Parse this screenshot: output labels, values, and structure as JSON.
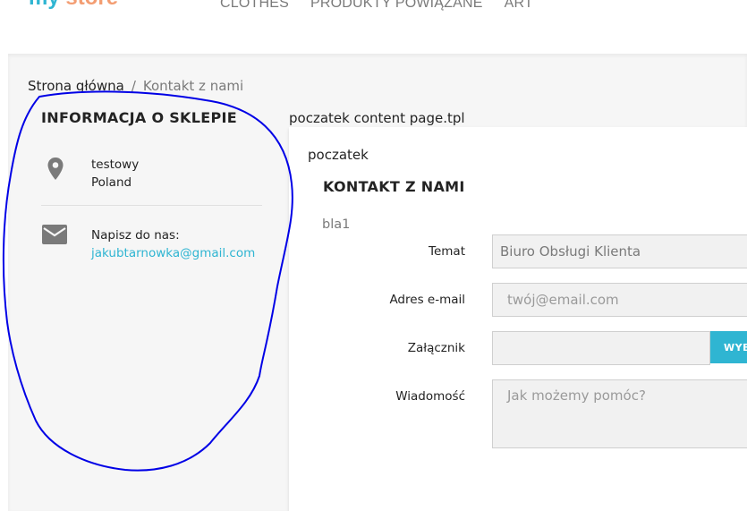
{
  "header": {
    "logo_part1": "my",
    "logo_part2": " store",
    "nav": [
      "CLOTHES",
      "PRODUKTY POWIĄZANE",
      "ART"
    ]
  },
  "breadcrumb": {
    "home": "Strona główna",
    "separator": "/",
    "current": "Kontakt z nami"
  },
  "store_info": {
    "title": "INFORMACJA O SKLEPIE",
    "address_line1": "testowy",
    "address_line2": "Poland",
    "mail_label": "Napisz do nas:",
    "email": "jakubtarnowka@gmail.com"
  },
  "content": {
    "pre_text": "poczatek content page.tpl",
    "card_start": "poczatek",
    "title": "KONTAKT Z NAMI",
    "bla": "bla1"
  },
  "form": {
    "subject_label": "Temat",
    "subject_value": "Biuro Obsługi Klienta",
    "email_label": "Adres e-mail",
    "email_placeholder": "twój@email.com",
    "attachment_label": "Załącznik",
    "attachment_button": "WYBI",
    "message_label": "Wiadomość",
    "message_placeholder": "Jak możemy pomóc?"
  },
  "colors": {
    "accent": "#2fb5d2",
    "annotation": "#0000e6"
  }
}
